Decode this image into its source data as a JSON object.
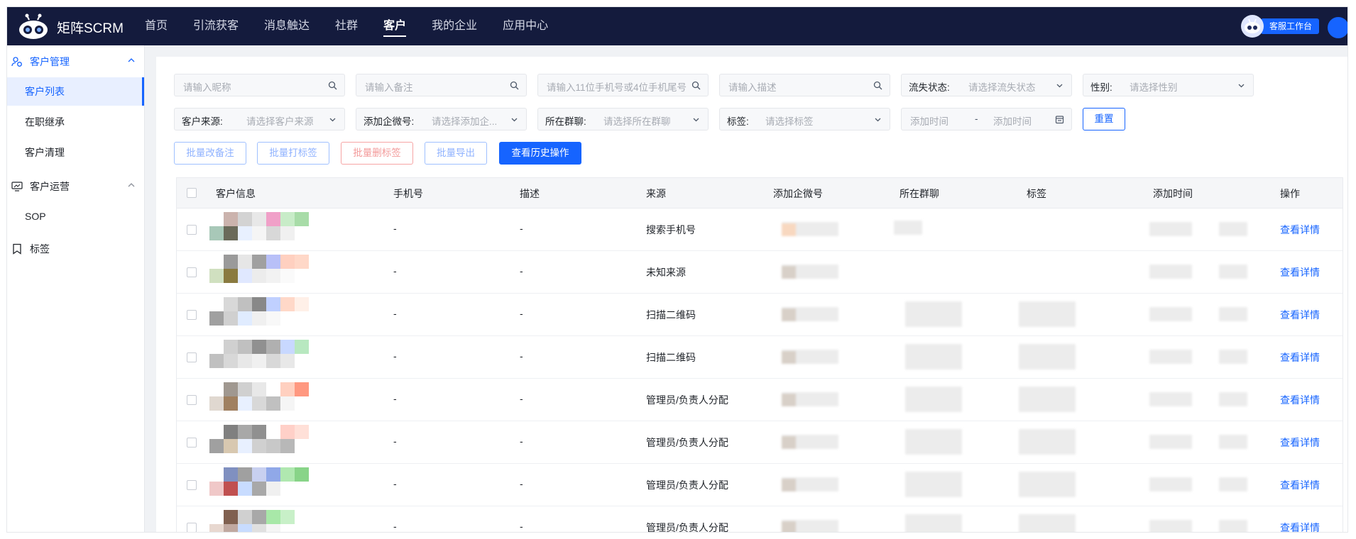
{
  "brand": {
    "name": "矩阵SCRM"
  },
  "nav": {
    "items": [
      {
        "label": "首页"
      },
      {
        "label": "引流获客"
      },
      {
        "label": "消息触达"
      },
      {
        "label": "社群"
      },
      {
        "label": "客户",
        "active": true
      },
      {
        "label": "我的企业"
      },
      {
        "label": "应用中心"
      }
    ],
    "service_label": "客服工作台"
  },
  "sidebar": {
    "groups": [
      {
        "label": "客户管理",
        "icon": "customer-group-icon",
        "expanded": true,
        "items": [
          {
            "label": "客户列表",
            "active": true
          },
          {
            "label": "在职继承"
          },
          {
            "label": "客户清理"
          }
        ]
      },
      {
        "label": "客户运营",
        "icon": "monitor-icon",
        "expanded": true,
        "items": [
          {
            "label": "SOP"
          }
        ]
      },
      {
        "label": "标签",
        "icon": "bookmark-icon"
      }
    ]
  },
  "filters": {
    "nickname_placeholder": "请输入昵称",
    "remark_placeholder": "请输入备注",
    "phone_placeholder": "请输入11位手机号或4位手机尾号",
    "desc_placeholder": "请输入描述",
    "lost_label": "流失状态:",
    "lost_placeholder": "请选择流失状态",
    "gender_label": "性别:",
    "gender_placeholder": "请选择性别",
    "source_label": "客户来源:",
    "source_placeholder": "请选择客户来源",
    "wx_label": "添加企微号:",
    "wx_placeholder": "请选择添加企...",
    "group_label": "所在群聊:",
    "group_placeholder": "请选择所在群聊",
    "tag_label": "标签:",
    "tag_placeholder": "请选择标签",
    "time_start": "添加时间",
    "time_sep": "-",
    "time_end": "添加时间",
    "reset_label": "重置"
  },
  "actions": {
    "batch_remark": "批量改备注",
    "batch_tag": "批量打标签",
    "batch_untag": "批量删标签",
    "batch_export": "批量导出",
    "history": "查看历史操作"
  },
  "table": {
    "columns": [
      "客户信息",
      "手机号",
      "描述",
      "来源",
      "添加企微号",
      "所在群聊",
      "标签",
      "添加时间",
      "操作"
    ],
    "rows": [
      {
        "phone": "-",
        "desc": "-",
        "source": "搜索手机号",
        "op": "查看详情"
      },
      {
        "phone": "-",
        "desc": "-",
        "source": "未知来源",
        "op": "查看详情"
      },
      {
        "phone": "-",
        "desc": "-",
        "source": "扫描二维码",
        "op": "查看详情"
      },
      {
        "phone": "-",
        "desc": "-",
        "source": "扫描二维码",
        "op": "查看详情"
      },
      {
        "phone": "-",
        "desc": "-",
        "source": "管理员/负责人分配",
        "op": "查看详情"
      },
      {
        "phone": "-",
        "desc": "-",
        "source": "管理员/负责人分配",
        "op": "查看详情"
      },
      {
        "phone": "-",
        "desc": "-",
        "source": "管理员/负责人分配",
        "op": "查看详情"
      },
      {
        "phone": "-",
        "desc": "-",
        "source": "管理员/负责人分配",
        "op": "查看详情"
      }
    ]
  },
  "colors": {
    "accent": "#1664ff",
    "nav_bg": "#141b3d",
    "danger": "#f39a9a"
  }
}
